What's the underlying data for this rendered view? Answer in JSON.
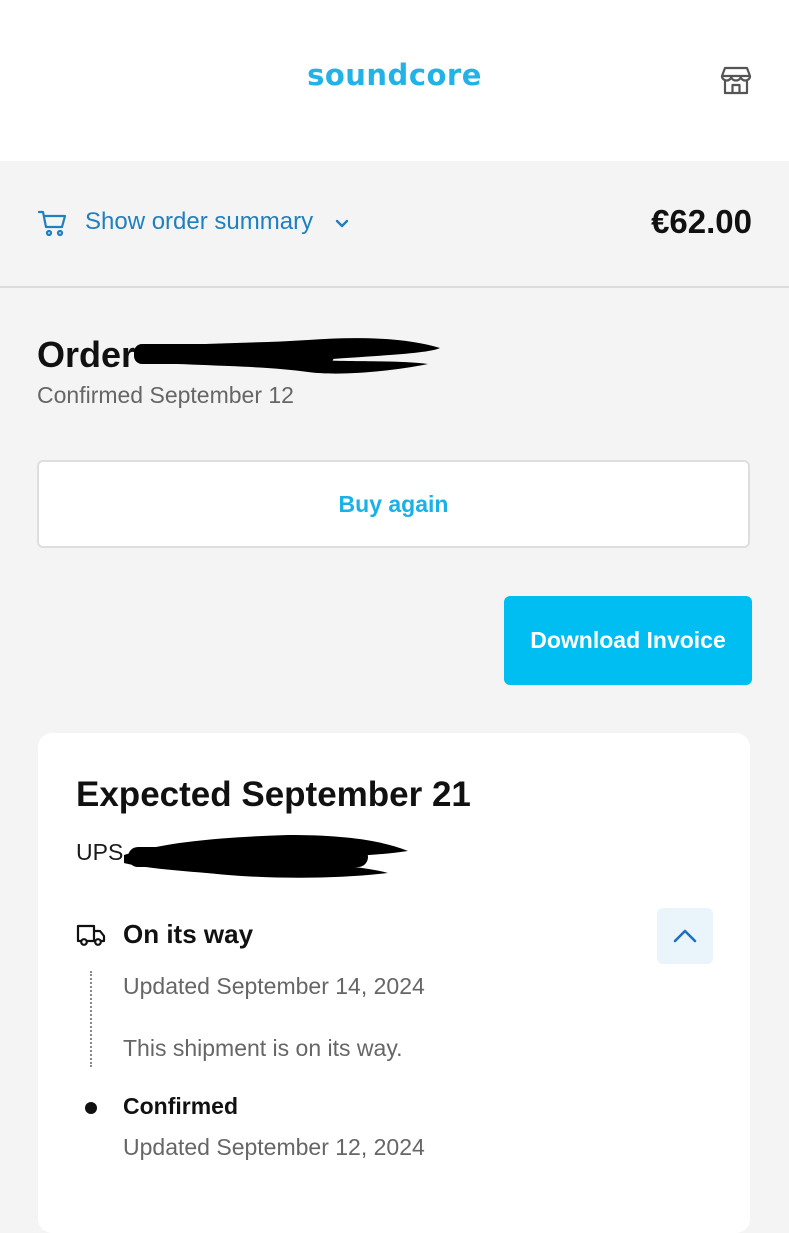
{
  "header": {
    "logo_text": "soundcore",
    "store_icon": "store-icon"
  },
  "summary": {
    "toggle_label": "Show order summary",
    "total": "€62.00",
    "cart_icon": "cart-icon",
    "chevron_icon": "chevron-down-icon"
  },
  "order": {
    "title": "Order",
    "confirmed_date": "Confirmed September 12"
  },
  "actions": {
    "buy_again": "Buy again",
    "download_invoice": "Download Invoice"
  },
  "shipment": {
    "expected": "Expected September 21",
    "carrier": "UPS",
    "status_title": "On its way",
    "status_updated": "Updated September 14, 2024",
    "status_message": "This shipment is on its way.",
    "previous_status": "Confirmed",
    "previous_updated": "Updated September 12, 2024"
  },
  "colors": {
    "brand": "#22b3e6",
    "primary_button": "#00bdf2",
    "link": "#1f7fbf"
  }
}
